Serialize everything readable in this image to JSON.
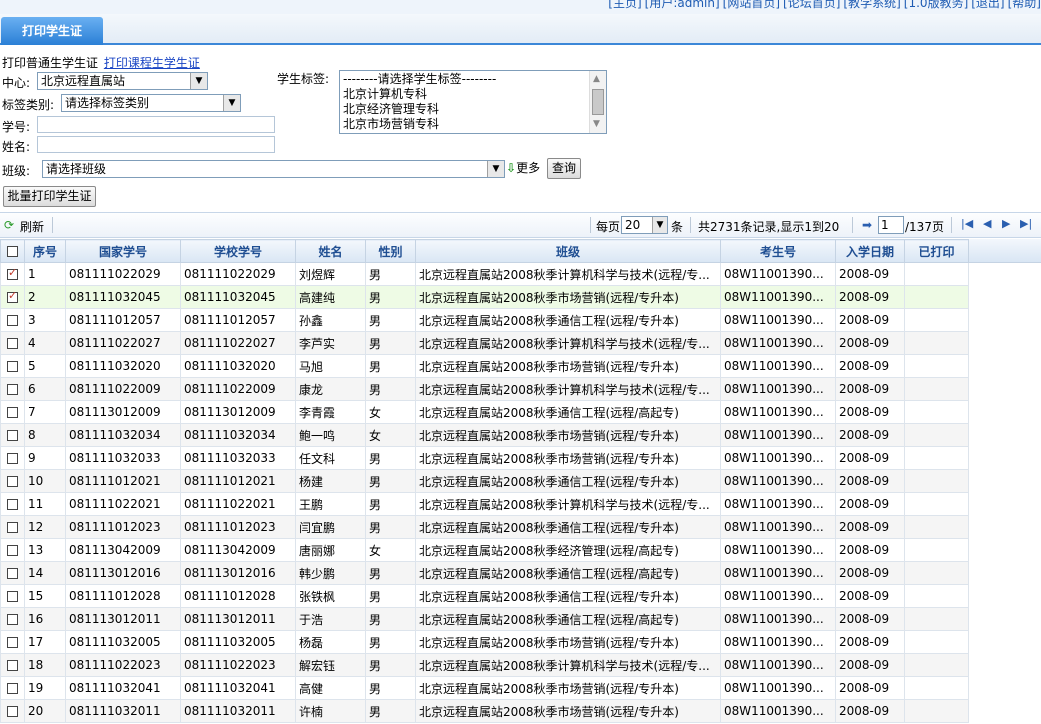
{
  "top_links": [
    "[主页]",
    "[用户:admin]",
    "[网站首页]",
    "[论坛首页]",
    "[教学系统]",
    "[1.0版教务]",
    "[退出]",
    "[帮助]"
  ],
  "tab": "打印学生证",
  "links": {
    "normal": "打印普通生学生证",
    "course": "打印课程生学生证"
  },
  "filters": {
    "center_label": "中心:",
    "center_value": "北京远程直属站",
    "tag_type_label": "标签类别:",
    "tag_type_value": "请选择标签类别",
    "stuno_label": "学号:",
    "name_label": "姓名:",
    "tag_label": "学生标签:",
    "tag_options": [
      "--------请选择学生标签--------",
      "北京计算机专科",
      "北京经济管理专科",
      "北京市场营销专科"
    ],
    "class_label": "班级:",
    "class_value": "请选择班级",
    "more": "更多",
    "query": "查询",
    "batch_print": "批量打印学生证"
  },
  "toolbar": {
    "refresh": "刷新",
    "per_page_prefix": "每页",
    "per_page": "20",
    "per_page_suffix": "条",
    "summary": "共2731条记录,显示1到20",
    "page": "1",
    "page_total": "/137页"
  },
  "columns": [
    "序号",
    "国家学号",
    "学校学号",
    "姓名",
    "性别",
    "班级",
    "考生号",
    "入学日期",
    "已打印"
  ],
  "rows": [
    {
      "checked": true,
      "no": "1",
      "nid": "081111022029",
      "sid": "081111022029",
      "name": "刘煜辉",
      "sex": "男",
      "class": "北京远程直属站2008秋季计算机科学与技术(远程/专...",
      "exam": "08W11001390...",
      "date": "2008-09",
      "printed": ""
    },
    {
      "checked": true,
      "no": "2",
      "nid": "081111032045",
      "sid": "081111032045",
      "name": "高建纯",
      "sex": "男",
      "class": "北京远程直属站2008秋季市场营销(远程/专升本)",
      "exam": "08W11001390...",
      "date": "2008-09",
      "printed": ""
    },
    {
      "checked": false,
      "no": "3",
      "nid": "081111012057",
      "sid": "081111012057",
      "name": "孙鑫",
      "sex": "男",
      "class": "北京远程直属站2008秋季通信工程(远程/专升本)",
      "exam": "08W11001390...",
      "date": "2008-09",
      "printed": ""
    },
    {
      "checked": false,
      "no": "4",
      "nid": "081111022027",
      "sid": "081111022027",
      "name": "李芦实",
      "sex": "男",
      "class": "北京远程直属站2008秋季计算机科学与技术(远程/专...",
      "exam": "08W11001390...",
      "date": "2008-09",
      "printed": ""
    },
    {
      "checked": false,
      "no": "5",
      "nid": "081111032020",
      "sid": "081111032020",
      "name": "马旭",
      "sex": "男",
      "class": "北京远程直属站2008秋季市场营销(远程/专升本)",
      "exam": "08W11001390...",
      "date": "2008-09",
      "printed": ""
    },
    {
      "checked": false,
      "no": "6",
      "nid": "081111022009",
      "sid": "081111022009",
      "name": "康龙",
      "sex": "男",
      "class": "北京远程直属站2008秋季计算机科学与技术(远程/专...",
      "exam": "08W11001390...",
      "date": "2008-09",
      "printed": ""
    },
    {
      "checked": false,
      "no": "7",
      "nid": "081113012009",
      "sid": "081113012009",
      "name": "李青霞",
      "sex": "女",
      "class": "北京远程直属站2008秋季通信工程(远程/高起专)",
      "exam": "08W11001390...",
      "date": "2008-09",
      "printed": ""
    },
    {
      "checked": false,
      "no": "8",
      "nid": "081111032034",
      "sid": "081111032034",
      "name": "鲍一鸣",
      "sex": "女",
      "class": "北京远程直属站2008秋季市场营销(远程/专升本)",
      "exam": "08W11001390...",
      "date": "2008-09",
      "printed": ""
    },
    {
      "checked": false,
      "no": "9",
      "nid": "081111032033",
      "sid": "081111032033",
      "name": "任文科",
      "sex": "男",
      "class": "北京远程直属站2008秋季市场营销(远程/专升本)",
      "exam": "08W11001390...",
      "date": "2008-09",
      "printed": ""
    },
    {
      "checked": false,
      "no": "10",
      "nid": "081111012021",
      "sid": "081111012021",
      "name": "杨建",
      "sex": "男",
      "class": "北京远程直属站2008秋季通信工程(远程/专升本)",
      "exam": "08W11001390...",
      "date": "2008-09",
      "printed": ""
    },
    {
      "checked": false,
      "no": "11",
      "nid": "081111022021",
      "sid": "081111022021",
      "name": "王鹏",
      "sex": "男",
      "class": "北京远程直属站2008秋季计算机科学与技术(远程/专...",
      "exam": "08W11001390...",
      "date": "2008-09",
      "printed": ""
    },
    {
      "checked": false,
      "no": "12",
      "nid": "081111012023",
      "sid": "081111012023",
      "name": "闫宜鹏",
      "sex": "男",
      "class": "北京远程直属站2008秋季通信工程(远程/专升本)",
      "exam": "08W11001390...",
      "date": "2008-09",
      "printed": ""
    },
    {
      "checked": false,
      "no": "13",
      "nid": "081113042009",
      "sid": "081113042009",
      "name": "唐丽娜",
      "sex": "女",
      "class": "北京远程直属站2008秋季经济管理(远程/高起专)",
      "exam": "08W11001390...",
      "date": "2008-09",
      "printed": ""
    },
    {
      "checked": false,
      "no": "14",
      "nid": "081113012016",
      "sid": "081113012016",
      "name": "韩少鹏",
      "sex": "男",
      "class": "北京远程直属站2008秋季通信工程(远程/高起专)",
      "exam": "08W11001390...",
      "date": "2008-09",
      "printed": ""
    },
    {
      "checked": false,
      "no": "15",
      "nid": "081111012028",
      "sid": "081111012028",
      "name": "张铁枫",
      "sex": "男",
      "class": "北京远程直属站2008秋季通信工程(远程/专升本)",
      "exam": "08W11001390...",
      "date": "2008-09",
      "printed": ""
    },
    {
      "checked": false,
      "no": "16",
      "nid": "081113012011",
      "sid": "081113012011",
      "name": "于浩",
      "sex": "男",
      "class": "北京远程直属站2008秋季通信工程(远程/高起专)",
      "exam": "08W11001390...",
      "date": "2008-09",
      "printed": ""
    },
    {
      "checked": false,
      "no": "17",
      "nid": "081111032005",
      "sid": "081111032005",
      "name": "杨磊",
      "sex": "男",
      "class": "北京远程直属站2008秋季市场营销(远程/专升本)",
      "exam": "08W11001390...",
      "date": "2008-09",
      "printed": ""
    },
    {
      "checked": false,
      "no": "18",
      "nid": "081111022023",
      "sid": "081111022023",
      "name": "解宏钰",
      "sex": "男",
      "class": "北京远程直属站2008秋季计算机科学与技术(远程/专...",
      "exam": "08W11001390...",
      "date": "2008-09",
      "printed": ""
    },
    {
      "checked": false,
      "no": "19",
      "nid": "081111032041",
      "sid": "081111032041",
      "name": "高健",
      "sex": "男",
      "class": "北京远程直属站2008秋季市场营销(远程/专升本)",
      "exam": "08W11001390...",
      "date": "2008-09",
      "printed": ""
    },
    {
      "checked": false,
      "no": "20",
      "nid": "081111032011",
      "sid": "081111032011",
      "name": "许楠",
      "sex": "男",
      "class": "北京远程直属站2008秋季市场营销(远程/专升本)",
      "exam": "08W11001390...",
      "date": "2008-09",
      "printed": ""
    }
  ]
}
